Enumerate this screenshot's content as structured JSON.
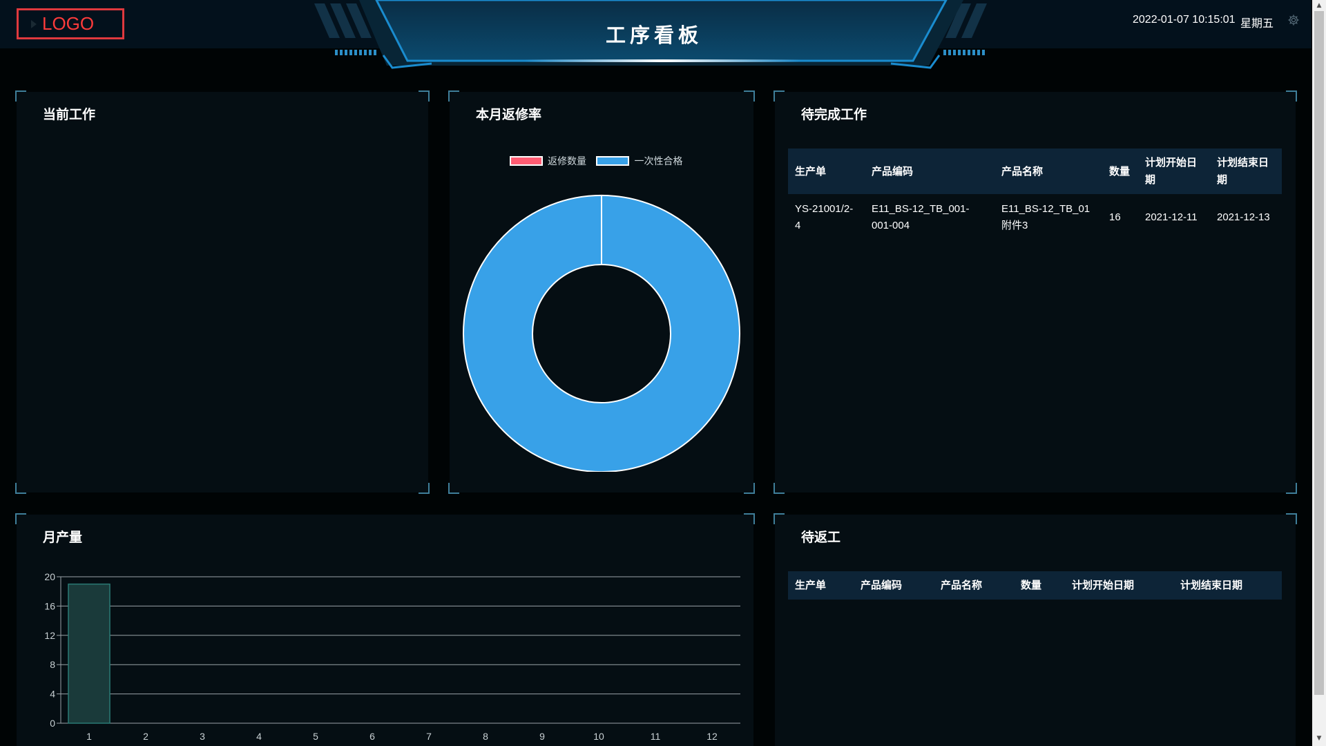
{
  "header": {
    "logo": "LOGO",
    "title": "工序看板",
    "datetime": "2022-01-07 10:15:01",
    "weekday": "星期五",
    "settings_icon": "gear-icon"
  },
  "panels": {
    "current_work": {
      "title": "当前工作"
    },
    "repair_rate": {
      "title": "本月返修率"
    },
    "pending_work": {
      "title": "待完成工作",
      "columns": [
        "生产单",
        "产品编码",
        "产品名称",
        "数量",
        "计划开始日期",
        "计划结束日期"
      ],
      "rows": [
        [
          "YS-21001/2-4",
          "E11_BS-12_TB_001-001-004",
          "E11_BS-12_TB_01附件3",
          "16",
          "2021-12-11",
          "2021-12-13"
        ]
      ]
    },
    "monthly_output": {
      "title": "月产量"
    },
    "pending_rework": {
      "title": "待返工",
      "columns": [
        "生产单",
        "产品编码",
        "产品名称",
        "数量",
        "计划开始日期",
        "计划结束日期"
      ]
    }
  },
  "colors": {
    "repair": "#ff5b72",
    "first_pass": "#38a1e8",
    "bar": "#1a3a3a",
    "bar_stroke": "#2a7a74",
    "panel_corner": "#3f7f9a"
  },
  "chart_data": [
    {
      "type": "pie",
      "title": "本月返修率",
      "legend": [
        "返修数量",
        "一次性合格"
      ],
      "legend_position": "top",
      "values": [
        0,
        100
      ],
      "series": [
        {
          "name": "返修数量",
          "value": 0,
          "color": "#ff5b72"
        },
        {
          "name": "一次性合格",
          "value": 100,
          "color": "#38a1e8"
        }
      ]
    },
    {
      "type": "bar",
      "title": "月产量",
      "categories": [
        "1",
        "2",
        "3",
        "4",
        "5",
        "6",
        "7",
        "8",
        "9",
        "10",
        "11",
        "12"
      ],
      "values": [
        19,
        0,
        0,
        0,
        0,
        0,
        0,
        0,
        0,
        0,
        0,
        0
      ],
      "ylim": [
        0,
        20
      ],
      "yticks": [
        "0",
        "4",
        "8",
        "12",
        "16",
        "20"
      ],
      "grid": true
    }
  ]
}
